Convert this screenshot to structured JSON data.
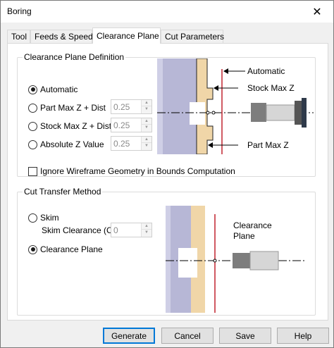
{
  "window": {
    "title": "Boring",
    "close_glyph": "✕"
  },
  "tabs": [
    {
      "label": "Tool",
      "active": false
    },
    {
      "label": "Feeds & Speeds",
      "active": false
    },
    {
      "label": "Clearance Plane",
      "active": true
    },
    {
      "label": "Cut Parameters",
      "active": false
    }
  ],
  "clearance_def": {
    "title": "Clearance Plane Definition",
    "options": [
      {
        "label": "Automatic",
        "checked": true
      },
      {
        "label": "Part Max Z + Dist",
        "checked": false,
        "value": "0.25"
      },
      {
        "label": "Stock Max Z + Dist",
        "checked": false,
        "value": "0.25"
      },
      {
        "label": "Absolute Z Value",
        "checked": false,
        "value": "0.25"
      }
    ],
    "ignore_checkbox": {
      "label": "Ignore Wireframe Geometry in Bounds Computation",
      "checked": false
    },
    "diagram_labels": {
      "automatic": "Automatic",
      "stock_max_z": "Stock Max Z",
      "part_max_z": "Part Max Z"
    }
  },
  "cut_transfer": {
    "title": "Cut Transfer Method",
    "options": [
      {
        "label": "Skim",
        "checked": false
      },
      {
        "label": "Clearance Plane",
        "checked": true
      }
    ],
    "skim_clearance": {
      "label": "Skim Clearance (C)",
      "value": "0"
    },
    "diagram_labels": {
      "clearance_line1": "Clearance",
      "clearance_line2": "Plane"
    }
  },
  "buttons": {
    "generate": "Generate",
    "cancel": "Cancel",
    "save": "Save",
    "help": "Help"
  },
  "colors": {
    "stock": "#b7b7d6",
    "part": "#f0d6a8",
    "clearance_line": "#c0232f",
    "default_button_border": "#0078d7"
  },
  "icons": {
    "spin_up": "▲",
    "spin_down": "▼"
  }
}
